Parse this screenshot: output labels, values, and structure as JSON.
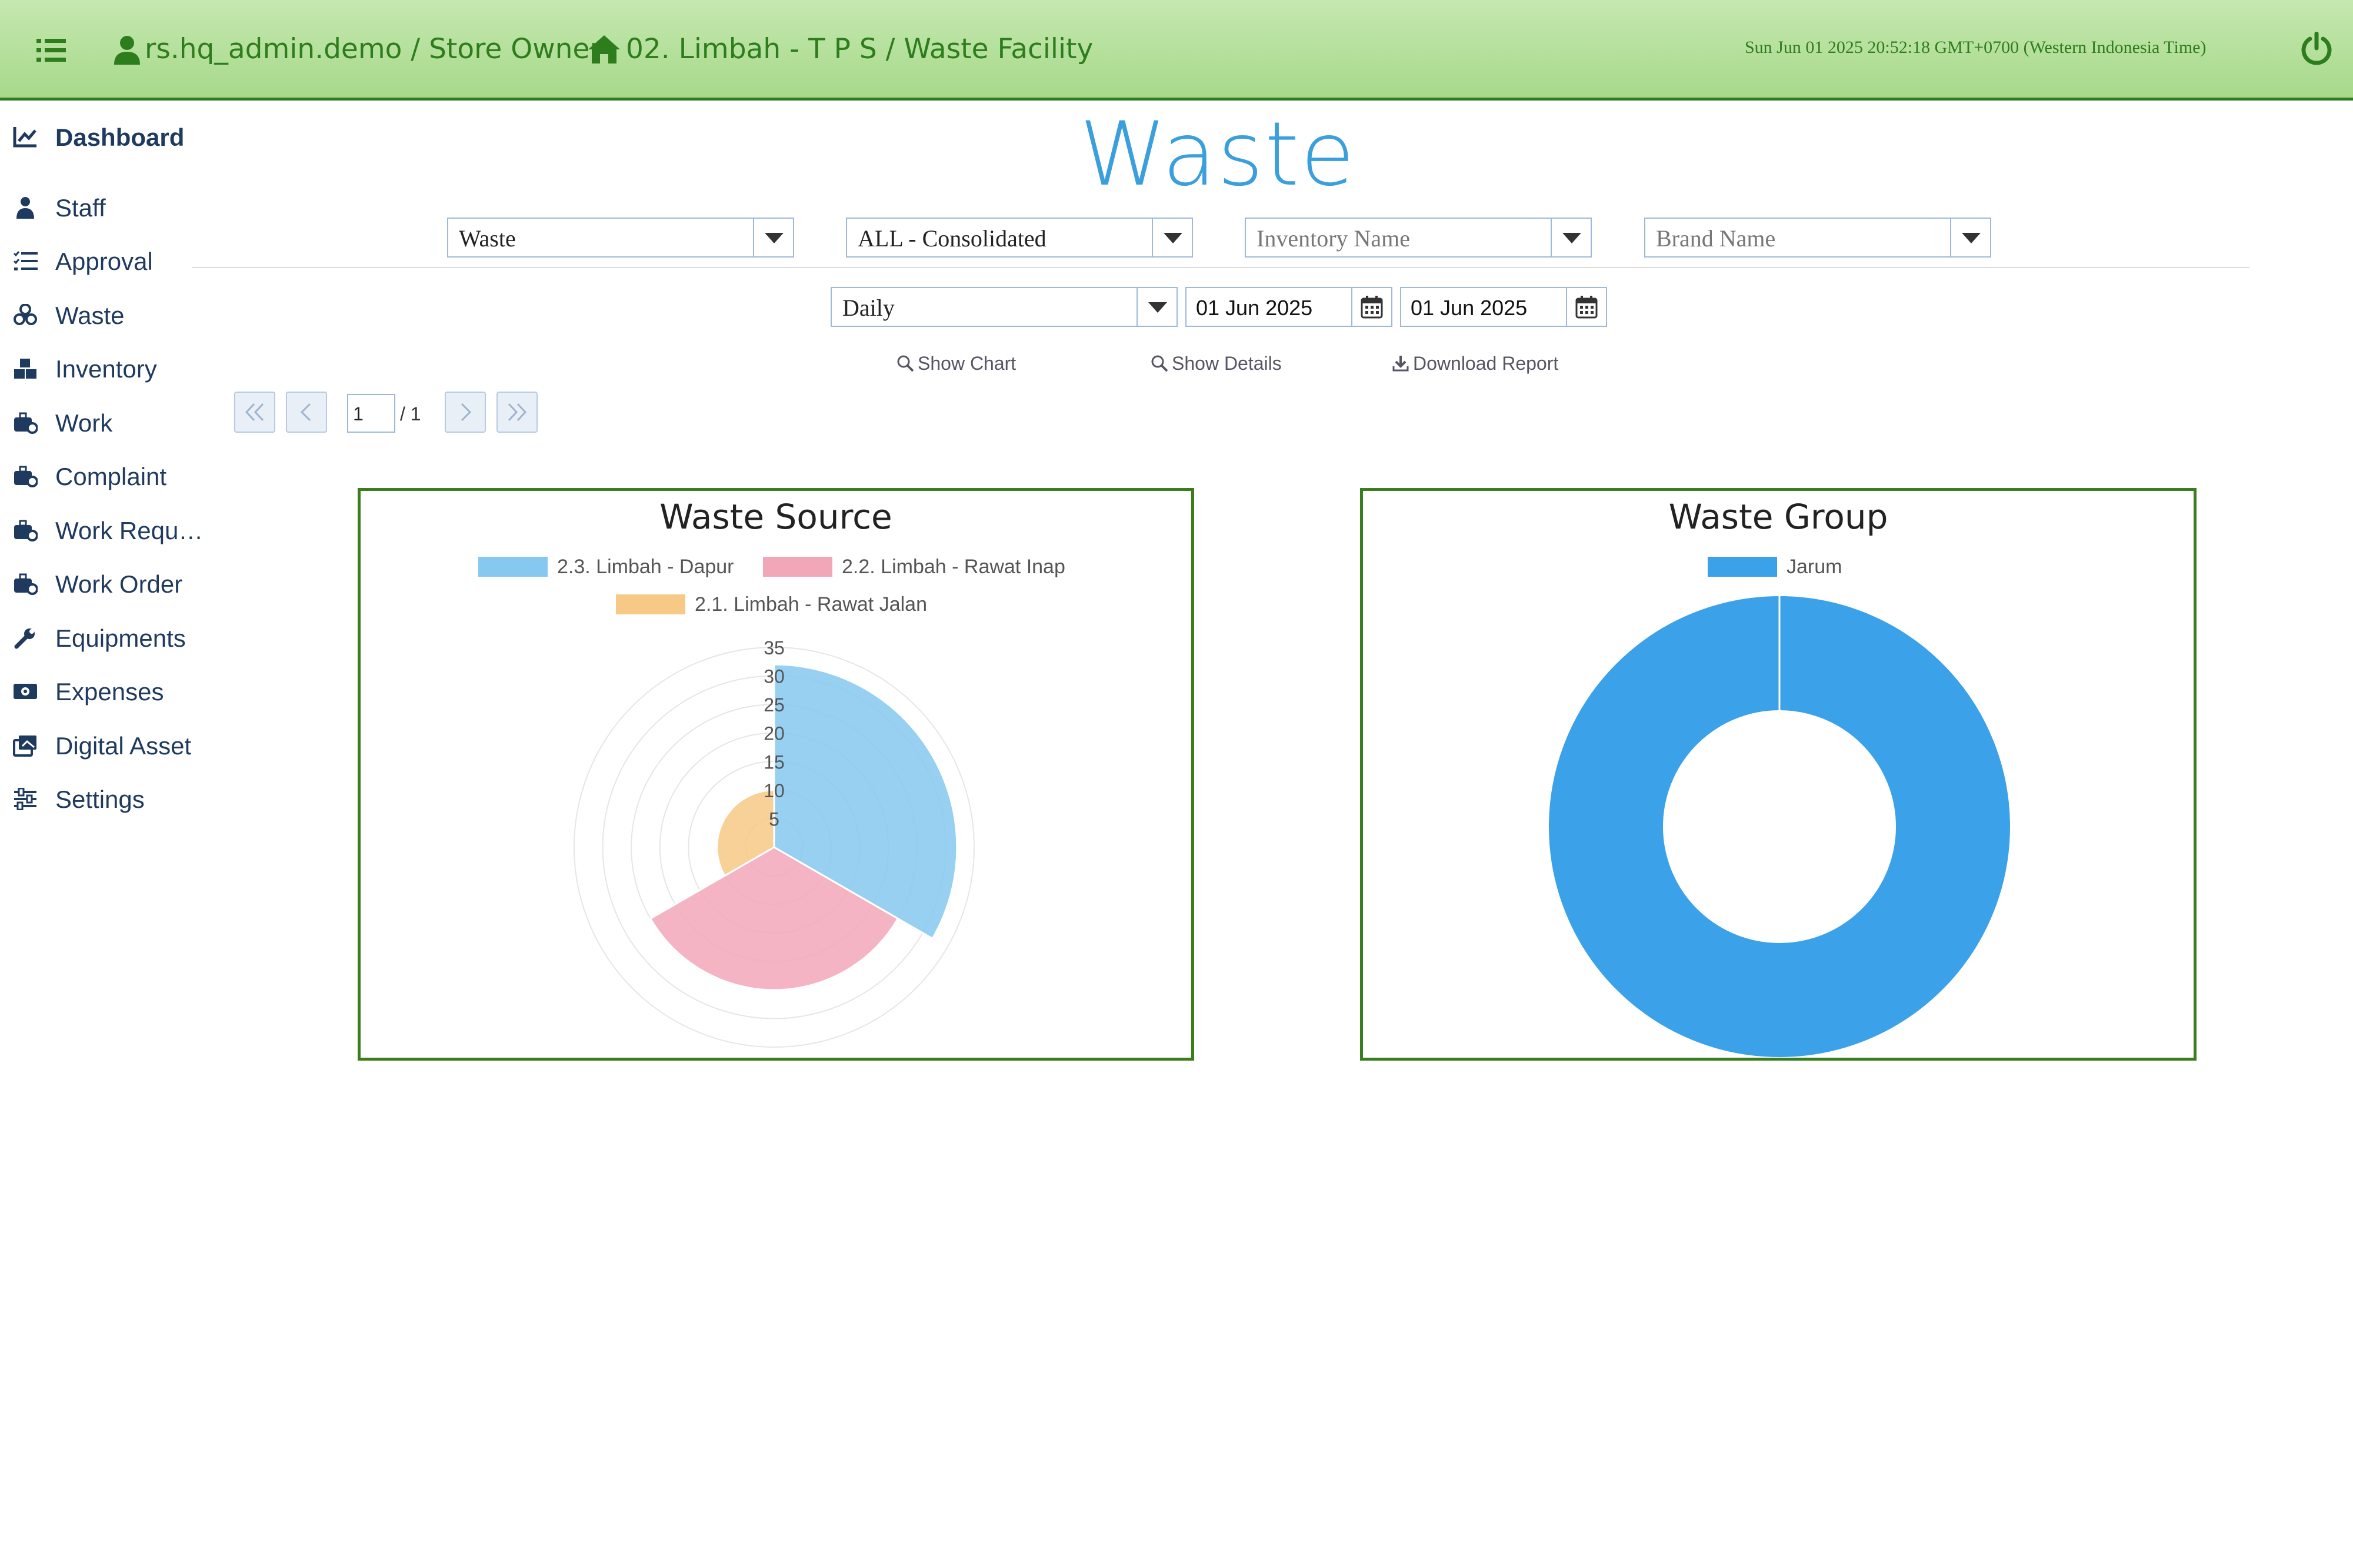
{
  "topbar": {
    "user": "rs.hq_admin.demo / Store Owner",
    "facility": "02. Limbah - T P S / Waste Facility",
    "clock": "Sun Jun 01 2025 20:52:18 GMT+0700 (Western Indonesia Time)"
  },
  "sidebar": {
    "items": [
      {
        "label": "Dashboard",
        "icon": "chart-line-icon"
      },
      {
        "label": "Staff",
        "icon": "user-tie-icon"
      },
      {
        "label": "Approval",
        "icon": "list-check-icon"
      },
      {
        "label": "Waste",
        "icon": "biohazard-icon"
      },
      {
        "label": "Inventory",
        "icon": "boxes-icon"
      },
      {
        "label": "Work",
        "icon": "toolbox-icon"
      },
      {
        "label": "Complaint",
        "icon": "toolbox-icon"
      },
      {
        "label": "Work Requ…",
        "icon": "toolbox-icon"
      },
      {
        "label": "Work Order",
        "icon": "toolbox-icon"
      },
      {
        "label": "Equipments",
        "icon": "wrench-icon"
      },
      {
        "label": "Expenses",
        "icon": "money-icon"
      },
      {
        "label": "Digital Asset",
        "icon": "images-icon"
      },
      {
        "label": "Settings",
        "icon": "sliders-icon"
      }
    ]
  },
  "page": {
    "title": "Waste"
  },
  "filters": {
    "type": "Waste",
    "scope": "ALL - Consolidated",
    "inventory_placeholder": "Inventory Name",
    "brand_placeholder": "Brand Name",
    "period": "Daily",
    "date_from": "01 Jun 2025",
    "date_to": "01 Jun 2025"
  },
  "actions": {
    "show_chart": "Show Chart",
    "show_details": "Show Details",
    "download_report": "Download Report"
  },
  "pager": {
    "page": "1",
    "total": "/ 1"
  },
  "colors": {
    "accent": "#3a9fdc",
    "topbar": "#b5e09c",
    "panel_border": "#3a7d1d",
    "blue": "#86c8f0",
    "pink": "#f2a7b8",
    "orange": "#f7c986",
    "doughnut": "#3ba1e8"
  },
  "chart_data": [
    {
      "type": "polarArea",
      "title": "Waste Source",
      "categories": [
        "2.3. Limbah - Dapur",
        "2.2. Limbah - Rawat Inap",
        "2.1. Limbah - Rawat Jalan"
      ],
      "values": [
        32,
        25,
        10
      ],
      "rlim": [
        0,
        35
      ],
      "ticks": [
        "5",
        "10",
        "15",
        "20",
        "25",
        "30",
        "35"
      ],
      "legend": "top"
    },
    {
      "type": "doughnut",
      "title": "Waste Group",
      "categories": [
        "Jarum"
      ],
      "values": [
        1
      ],
      "legend": "top"
    }
  ]
}
